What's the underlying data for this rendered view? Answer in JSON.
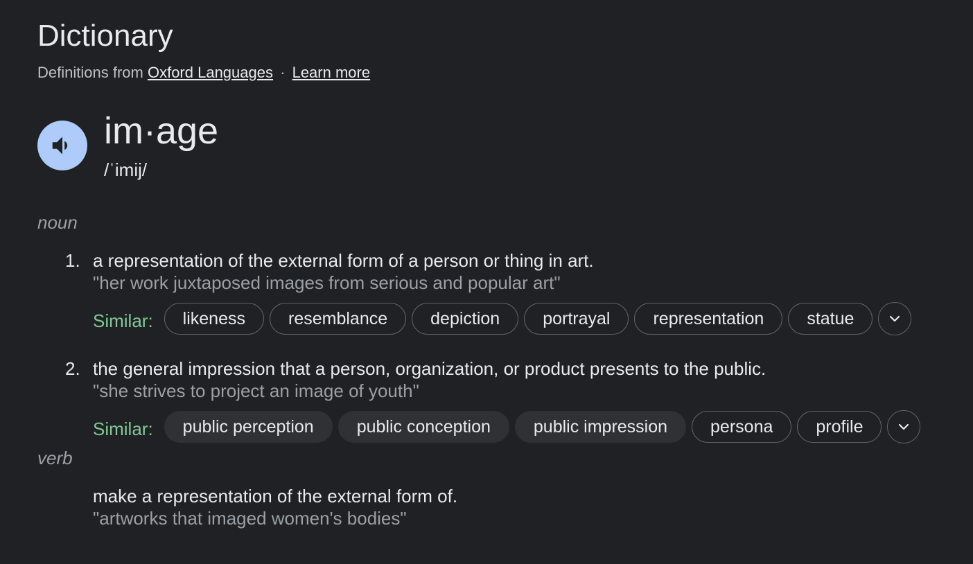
{
  "header": {
    "title": "Dictionary",
    "source_prefix": "Definitions from",
    "source_link": "Oxford Languages",
    "separator": "·",
    "learn_more": "Learn more"
  },
  "entry": {
    "speaker_icon": "volume-icon",
    "word": "im·age",
    "phonetic": "/ˈimij/"
  },
  "noun": {
    "label": "noun",
    "definitions": [
      {
        "number": "1.",
        "text": "a representation of the external form of a person or thing in art.",
        "example": "\"her work juxtaposed images from serious and popular art\"",
        "similar_label": "Similar:",
        "similar": [
          "likeness",
          "resemblance",
          "depiction",
          "portrayal",
          "representation",
          "statue"
        ]
      },
      {
        "number": "2.",
        "text": "the general impression that a person, organization, or product presents to the public.",
        "example": "\"she strives to project an image of youth\"",
        "similar_label": "Similar:",
        "similar": [
          "public perception",
          "public conception",
          "public impression",
          "persona",
          "profile"
        ]
      }
    ]
  },
  "verb": {
    "label": "verb",
    "text": "make a representation of the external form of.",
    "example": "\"artworks that imaged women's bodies\""
  },
  "colors": {
    "background": "#202124",
    "speaker_bg": "#aecbfa",
    "similar_label": "#81c995"
  }
}
